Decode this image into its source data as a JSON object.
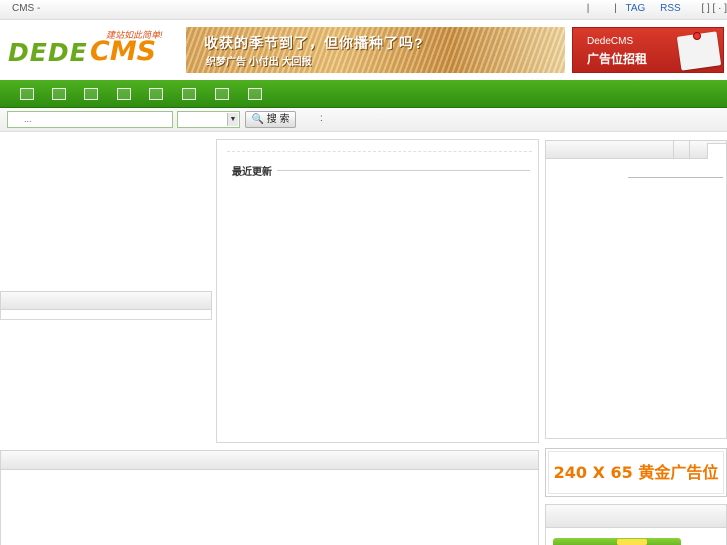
{
  "topbar": {
    "site_title": "CMS -",
    "sep1": "|",
    "sep2": "|",
    "tag_link": "TAG",
    "rss_link": "RSS",
    "bracket": "[    ] [ · ]"
  },
  "header": {
    "logo_dede": "DEDE",
    "logo_cms": "CMS",
    "logo_slogan": "建站如此简单!",
    "banner1_line1": "收获的季节到了，但你播种了吗?",
    "banner1_line2": "织梦广告  小付出  大回报",
    "banner2_line1": "DedeCMS",
    "banner2_line2": "广告位招租"
  },
  "nav": {
    "item_count": 8
  },
  "search": {
    "input_value": "...",
    "button_label": "🔍 搜 索",
    "hint": ":"
  },
  "main": {
    "recent_title": "最近更新"
  },
  "ads": {
    "gold_ad": "240 X 65 黄金广告位"
  },
  "colors": {
    "nav_green": "#3a9b15",
    "accent_orange": "#f07800",
    "link_blue": "#2a62b4"
  }
}
